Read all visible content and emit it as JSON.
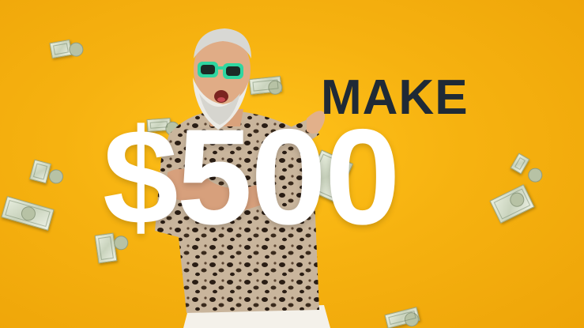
{
  "headline": {
    "top_text": "MAKE",
    "amount_text": "$500"
  },
  "colors": {
    "background": "#f6b210",
    "top_text": "#1f2a36",
    "amount_text": "#ffffff",
    "sunglasses": "#2fd6a0"
  }
}
